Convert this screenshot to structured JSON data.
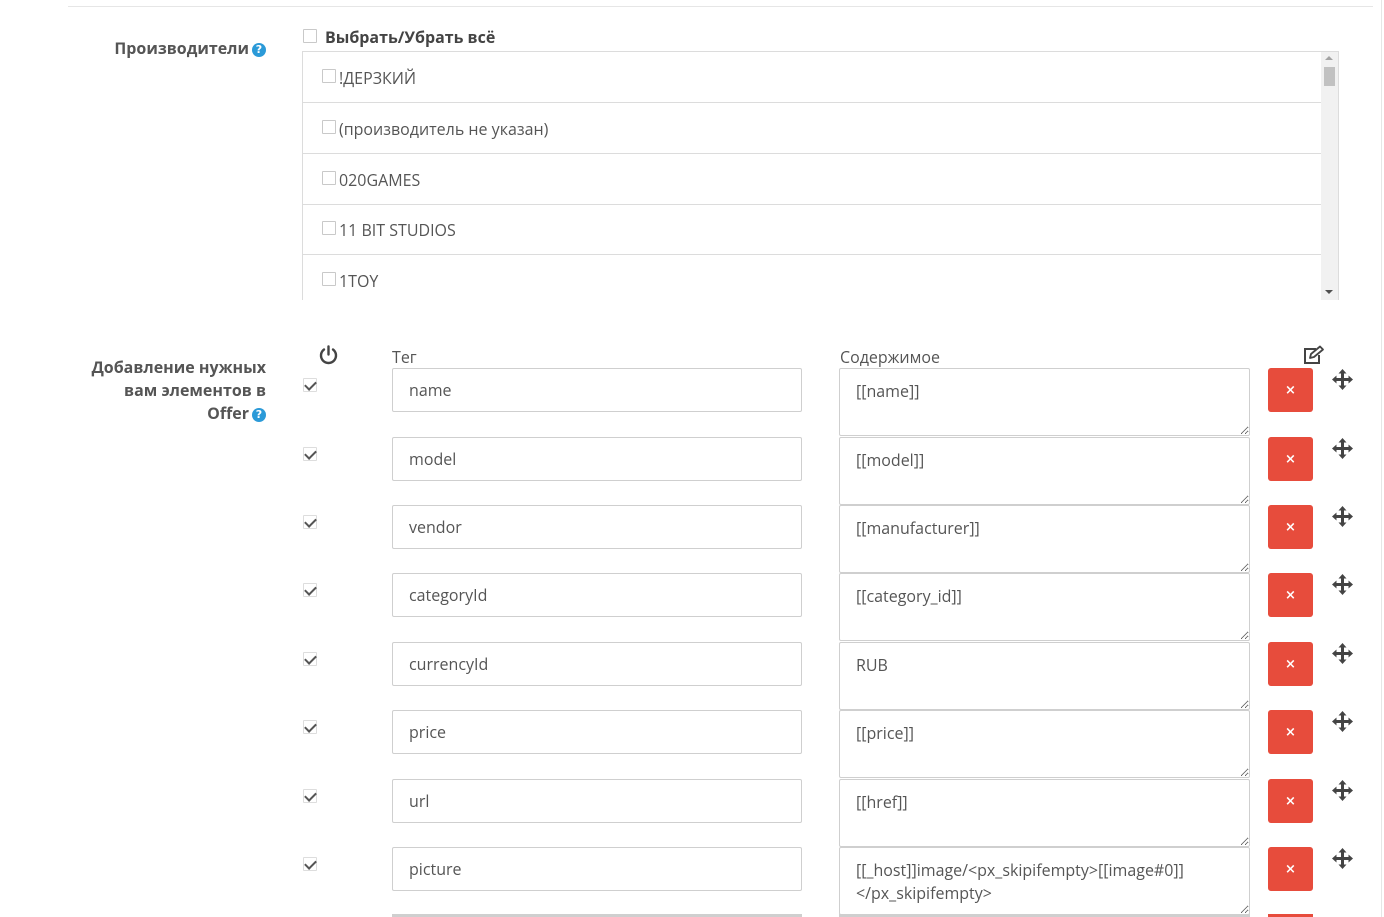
{
  "manufacturers": {
    "label": "Производители",
    "help_icon": "?",
    "select_all_label": "Выбрать/Убрать всё",
    "items": [
      {
        "name": "!ДЕРЗКИЙ",
        "checked": false
      },
      {
        "name": "(производитель не указан)",
        "checked": false
      },
      {
        "name": "020GAMES",
        "checked": false
      },
      {
        "name": "11 BIT STUDIOS",
        "checked": false
      },
      {
        "name": "1TOY",
        "checked": false
      }
    ]
  },
  "offer_elements": {
    "label_line1": "Добавление нужных",
    "label_line2": "вам элементов в",
    "label_line3": "Offer",
    "help_icon": "?",
    "column_tag": "Тег",
    "column_content": "Содержимое",
    "delete_label": "×",
    "rows": [
      {
        "enabled": true,
        "tag": "name",
        "content": "[[name]]"
      },
      {
        "enabled": true,
        "tag": "model",
        "content": "[[model]]"
      },
      {
        "enabled": true,
        "tag": "vendor",
        "content": "[[manufacturer]]"
      },
      {
        "enabled": true,
        "tag": "categoryId",
        "content": "[[category_id]]"
      },
      {
        "enabled": true,
        "tag": "currencyId",
        "content": "RUB"
      },
      {
        "enabled": true,
        "tag": "price",
        "content": "[[price]]"
      },
      {
        "enabled": true,
        "tag": "url",
        "content": "[[href]]"
      },
      {
        "enabled": true,
        "tag": "picture",
        "content": "[[_host]]image/<px_skipifempty>[[image#0]]</px_skipifempty>"
      }
    ]
  },
  "colors": {
    "delete_button": "#e74c3c",
    "help_icon": "#2b9ad8"
  }
}
